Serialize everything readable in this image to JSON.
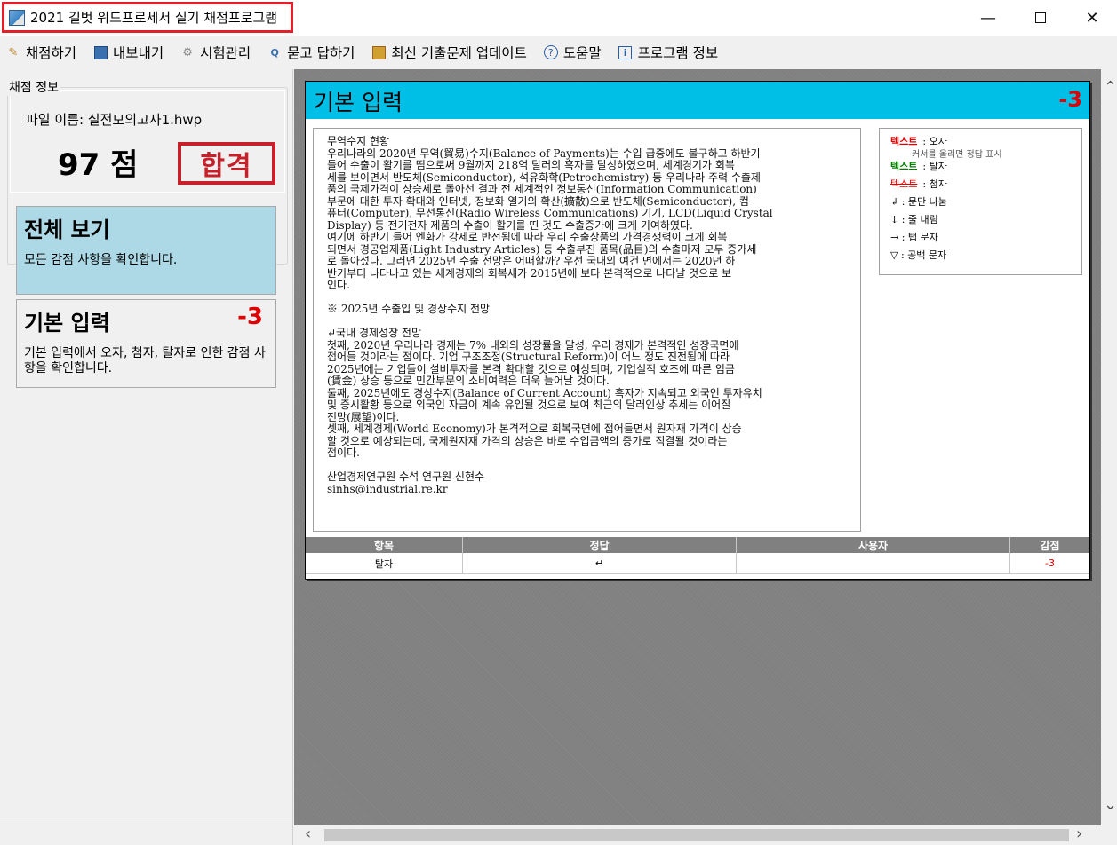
{
  "window": {
    "title": "2021 길벗 워드프로세서 실기 채점프로그램"
  },
  "menu": [
    {
      "label": "채점하기",
      "icon": "pencil-icon"
    },
    {
      "label": "내보내기",
      "icon": "save-icon"
    },
    {
      "label": "시험관리",
      "icon": "settings-icon"
    },
    {
      "label": "묻고 답하기",
      "icon": "qa-icon"
    },
    {
      "label": "최신 기출문제 업데이트",
      "icon": "gift-icon"
    },
    {
      "label": "도움말",
      "icon": "help-icon"
    },
    {
      "label": "프로그램 정보",
      "icon": "info-icon"
    }
  ],
  "score_info": {
    "legend": "채점 정보",
    "file_name": "파일 이름: 실전모의고사1.hwp",
    "score": "97 점",
    "result": "합격"
  },
  "cards": {
    "all": {
      "title": "전체 보기",
      "desc": "모든 감점 사항을 확인합니다."
    },
    "basic": {
      "title": "기본 입력",
      "score": "-3",
      "desc": "기본 입력에서 오자, 첨자, 탈자로 인한 감점 사항을 확인합니다."
    }
  },
  "document": {
    "title": "기본 입력",
    "score": "-3",
    "lines": [
      "무역수지 현황",
      "우리나라의 2020년 무역(貿易)수지(Balance of Payments)는 수입 급증에도 불구하고 하반기",
      "들어 수출이 활기를 띰으로써 9월까지 218억 달러의 흑자를 달성하였으며, 세계경기가 회복",
      "세를 보이면서 반도체(Semiconductor), 석유화학(Petrochemistry) 등 우리나라 주력 수출제",
      "품의 국제가격이 상승세로 돌아선 결과 전 세계적인 정보통신(Information Communication)",
      "부문에 대한 투자 확대와 인터넷, 정보화 열기의 확산(擴散)으로 반도체(Semiconductor), 컴",
      "퓨터(Computer), 무선통신(Radio Wireless Communications) 기기, LCD(Liquid Crystal",
      "Display) 등 전기전자 제품의 수출이 활기를 띤 것도 수출증가에 크게 기여하였다.",
      "여기에 하반기 들어 엔화가 강세로 반전됨에 따라 우리 수출상품의 가격경쟁력이 크게 회복",
      "되면서 경공업제품(Light Industry Articles) 등 수출부진 품목(品目)의 수출마저 모두 증가세",
      "로 돌아섰다. 그러면 2025년 수출 전망은 어떠할까? 우선 국내외 여건 면에서는 2020년 하",
      "반기부터 나타나고 있는 세계경제의 회복세가 2015년에 보다 본격적으로 나타날 것으로 보",
      "인다.",
      "",
      "※ 2025년 수출입 및 경상수지 전망",
      "",
      "↵국내 경제성장 전망",
      "첫째, 2020년 우리나라 경제는 7% 내외의 성장률을 달성, 우리 경제가 본격적인 성장국면에",
      "접어들 것이라는 점이다. 기업 구조조정(Structural Reform)이 어느 정도 진전됨에 따라",
      "2025년에는 기업들이 설비투자를 본격 확대할 것으로 예상되며, 기업실적 호조에 따른 임금",
      "(賃金) 상승 등으로 민간부문의 소비여력은 더욱 늘어날 것이다.",
      "둘째, 2025년에도 경상수지(Balance of Current Account) 흑자가 지속되고 외국인 투자유치",
      "및 증시활황 등으로 외국인 자금이 계속 유입될 것으로 보여 최근의 달러인상 추세는 이어질",
      "전망(展望)이다.",
      "셋째, 세계경제(World Economy)가 본격적으로 회복국면에 접어들면서 원자재 가격이 상승",
      "할 것으로 예상되는데, 국제원자재 가격의 상승은 바로 수입금액의 증가로 직결될 것이라는",
      "점이다.",
      "",
      "산업경제연구원 수석 연구원 신현수",
      "sinhs@industrial.re.kr"
    ]
  },
  "legend": {
    "typo_sample": "텍스트",
    "typo_label": ": 오자",
    "typo_hint": "커서를 올리면 정답 표시",
    "missing_sample": "텍스트",
    "missing_label": ": 탈자",
    "extra_sample": "텍스트",
    "extra_label": ": 첨자",
    "para": "↲ : 문단 나눔",
    "line": "↓ : 줄 내림",
    "tab": "→ : 탭 문자",
    "space": "▽ : 공백 문자",
    "colors": {
      "typo": "#e00000",
      "missing": "#008000"
    }
  },
  "table": {
    "headers": [
      "항목",
      "정답",
      "사용자",
      "감점"
    ],
    "rows": [
      {
        "item": "탈자",
        "answer": "↵",
        "user": "",
        "deduct": "-3"
      }
    ]
  },
  "colors": {
    "header_bg": "#00bfe7",
    "active_card": "#add8e6",
    "deduct": "#e00000",
    "title_border": "#e0202a"
  }
}
